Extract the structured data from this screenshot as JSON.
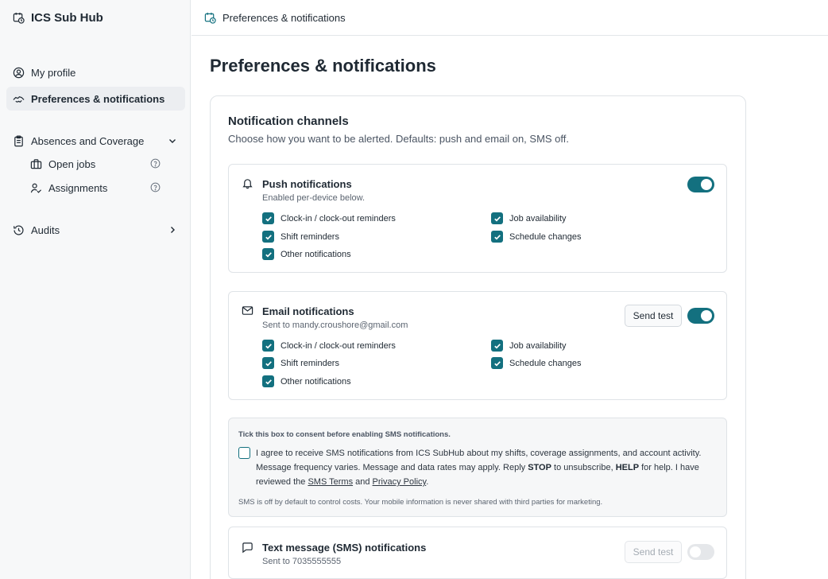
{
  "app": {
    "name": "ICS Sub Hub"
  },
  "sidebar": {
    "items": [
      {
        "label": "My profile",
        "icon": "user-circle-icon"
      },
      {
        "label": "Preferences & notifications",
        "icon": "handshake-icon",
        "active": true
      },
      {
        "label": "Absences and Coverage",
        "icon": "clipboard-icon",
        "expanded": true
      },
      {
        "label": "Audits",
        "icon": "history-icon"
      }
    ],
    "subitems": [
      {
        "label": "Open jobs",
        "icon": "briefcase-icon"
      },
      {
        "label": "Assignments",
        "icon": "user-check-icon"
      }
    ]
  },
  "topbar": {
    "title": "Preferences & notifications"
  },
  "page": {
    "title": "Preferences & notifications"
  },
  "channels_card": {
    "title": "Notification channels",
    "subtitle": "Choose how you want to be alerted. Defaults: push and email on, SMS off."
  },
  "push": {
    "title": "Push notifications",
    "subtitle": "Enabled per-device below.",
    "enabled": true,
    "options": [
      {
        "label": "Clock-in / clock-out reminders",
        "checked": true
      },
      {
        "label": "Job availability",
        "checked": true
      },
      {
        "label": "Shift reminders",
        "checked": true
      },
      {
        "label": "Schedule changes",
        "checked": true
      },
      {
        "label": "Other notifications",
        "checked": true
      }
    ]
  },
  "email": {
    "title": "Email notifications",
    "subtitle": "Sent to mandy.croushore@gmail.com",
    "send_test": "Send test",
    "enabled": true,
    "options": [
      {
        "label": "Clock-in / clock-out reminders",
        "checked": true
      },
      {
        "label": "Job availability",
        "checked": true
      },
      {
        "label": "Shift reminders",
        "checked": true
      },
      {
        "label": "Schedule changes",
        "checked": true
      },
      {
        "label": "Other notifications",
        "checked": true
      }
    ]
  },
  "consent": {
    "heading": "Tick this box to consent before enabling SMS notifications.",
    "checked": false,
    "text_1": "I agree to receive SMS notifications from ICS SubHub about my shifts, coverage assignments, and account activity. Message frequency varies. Message and data rates may apply. Reply ",
    "stop": "STOP",
    "text_2": " to unsubscribe, ",
    "help": "HELP",
    "text_3": " for help. I have reviewed the ",
    "sms_terms": "SMS Terms",
    "text_4": " and ",
    "privacy": "Privacy Policy",
    "text_5": ".",
    "footnote": "SMS is off by default to control costs. Your mobile information is never shared with third parties for marketing."
  },
  "sms": {
    "title": "Text message (SMS) notifications",
    "subtitle": "Sent to 7035555555",
    "send_test": "Send test",
    "enabled": false
  },
  "colors": {
    "accent": "#13707f",
    "sidebar_bg": "#f7f8f9",
    "border": "#dfe3e7"
  }
}
